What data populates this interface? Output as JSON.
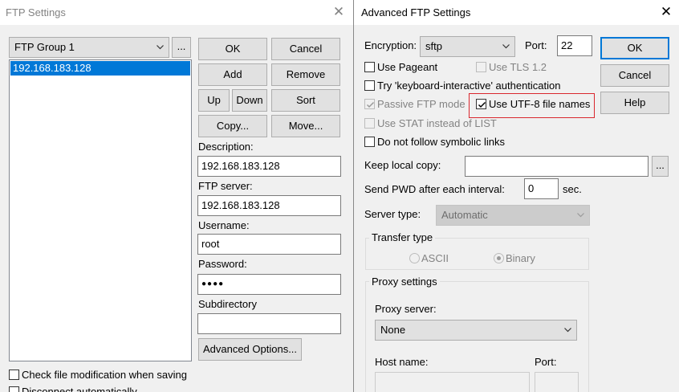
{
  "left_dialog": {
    "title": "FTP Settings",
    "group_select": "FTP Group 1",
    "group_more": "...",
    "server_list": [
      "192.168.183.128"
    ],
    "buttons": {
      "ok": "OK",
      "cancel": "Cancel",
      "add": "Add",
      "remove": "Remove",
      "up": "Up",
      "down": "Down",
      "sort": "Sort",
      "copy": "Copy...",
      "move": "Move...",
      "advanced": "Advanced Options..."
    },
    "fields": {
      "description_label": "Description:",
      "description_value": "192.168.183.128",
      "server_label": "FTP server:",
      "server_value": "192.168.183.128",
      "username_label": "Username:",
      "username_value": "root",
      "password_label": "Password:",
      "password_value": "●●●●",
      "subdir_label": "Subdirectory",
      "subdir_value": ""
    },
    "checkboxes": {
      "check_modification": "Check file modification when saving",
      "disconnect": "Disconnect automatically"
    }
  },
  "right_dialog": {
    "title": "Advanced FTP Settings",
    "encryption_label": "Encryption:",
    "encryption_value": "sftp",
    "port_label": "Port:",
    "port_value": "22",
    "buttons": {
      "ok": "OK",
      "cancel": "Cancel",
      "help": "Help",
      "browse": "..."
    },
    "options": {
      "use_pageant": "Use Pageant",
      "use_tls": "Use TLS 1.2",
      "keyboard_interactive": "Try 'keyboard-interactive' authentication",
      "passive_ftp": "Passive FTP mode",
      "utf8": "Use UTF-8 file names",
      "use_stat": "Use STAT instead of LIST",
      "no_symlinks": "Do not follow symbolic links"
    },
    "keep_local_label": "Keep local copy:",
    "keep_local_value": "",
    "send_pwd_label": "Send PWD after each interval:",
    "send_pwd_value": "0",
    "send_pwd_unit": "sec.",
    "server_type_label": "Server type:",
    "server_type_value": "Automatic",
    "transfer_type_title": "Transfer type",
    "transfer_ascii": "ASCII",
    "transfer_binary": "Binary",
    "proxy_title": "Proxy settings",
    "proxy_server_label": "Proxy server:",
    "proxy_server_value": "None",
    "host_name_label": "Host name:",
    "proxy_port_label": "Port:",
    "colors": {
      "highlight_box": "#d9272e",
      "selection": "#0078d7"
    }
  }
}
